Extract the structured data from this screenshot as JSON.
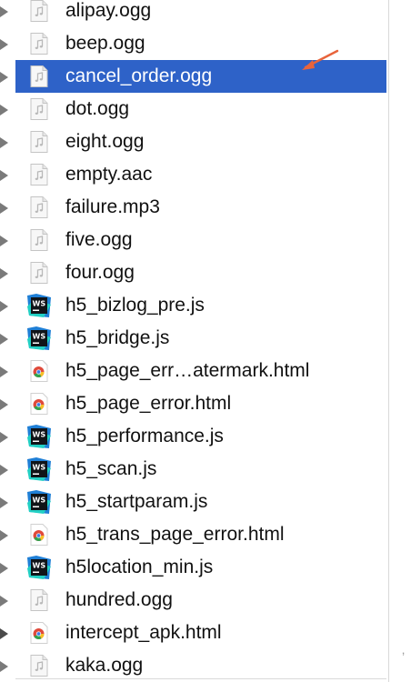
{
  "file_list": {
    "items": [
      {
        "name": "alipay.ogg",
        "type": "audio"
      },
      {
        "name": "beep.ogg",
        "type": "audio"
      },
      {
        "name": "cancel_order.ogg",
        "type": "audio",
        "selected": true
      },
      {
        "name": "dot.ogg",
        "type": "audio"
      },
      {
        "name": "eight.ogg",
        "type": "audio"
      },
      {
        "name": "empty.aac",
        "type": "audio"
      },
      {
        "name": "failure.mp3",
        "type": "audio"
      },
      {
        "name": "five.ogg",
        "type": "audio"
      },
      {
        "name": "four.ogg",
        "type": "audio"
      },
      {
        "name": "h5_bizlog_pre.js",
        "type": "webstorm-js"
      },
      {
        "name": "h5_bridge.js",
        "type": "webstorm-js"
      },
      {
        "name": "h5_page_err…atermark.html",
        "type": "chrome-html"
      },
      {
        "name": "h5_page_error.html",
        "type": "chrome-html"
      },
      {
        "name": "h5_performance.js",
        "type": "webstorm-js"
      },
      {
        "name": "h5_scan.js",
        "type": "webstorm-js"
      },
      {
        "name": "h5_startparam.js",
        "type": "webstorm-js"
      },
      {
        "name": "h5_trans_page_error.html",
        "type": "chrome-html"
      },
      {
        "name": "h5location_min.js",
        "type": "webstorm-js"
      },
      {
        "name": "hundred.ogg",
        "type": "audio"
      },
      {
        "name": "intercept_apk.html",
        "type": "chrome-html"
      },
      {
        "name": "kaka.ogg",
        "type": "audio"
      }
    ]
  },
  "colors": {
    "selection": "#2e62c8",
    "annotation_arrow": "#e8643c",
    "webstorm_blue": "#1f7fd6",
    "webstorm_dark": "#101418"
  },
  "annotation": {
    "icon": "orange-arrow-icon"
  }
}
